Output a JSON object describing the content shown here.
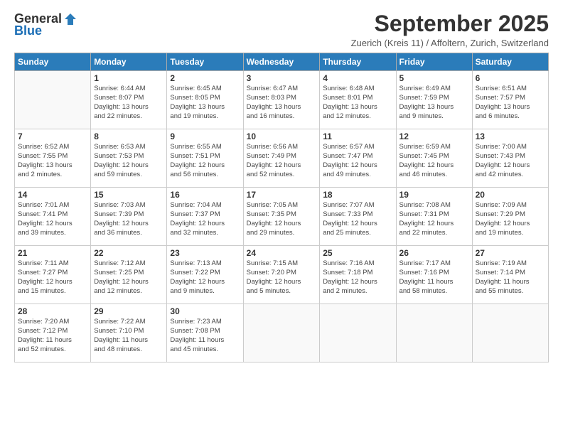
{
  "logo": {
    "general": "General",
    "blue": "Blue"
  },
  "header": {
    "title": "September 2025",
    "subtitle": "Zuerich (Kreis 11) / Affoltern, Zurich, Switzerland"
  },
  "columns": [
    "Sunday",
    "Monday",
    "Tuesday",
    "Wednesday",
    "Thursday",
    "Friday",
    "Saturday"
  ],
  "weeks": [
    [
      {
        "day": "",
        "info": ""
      },
      {
        "day": "1",
        "info": "Sunrise: 6:44 AM\nSunset: 8:07 PM\nDaylight: 13 hours\nand 22 minutes."
      },
      {
        "day": "2",
        "info": "Sunrise: 6:45 AM\nSunset: 8:05 PM\nDaylight: 13 hours\nand 19 minutes."
      },
      {
        "day": "3",
        "info": "Sunrise: 6:47 AM\nSunset: 8:03 PM\nDaylight: 13 hours\nand 16 minutes."
      },
      {
        "day": "4",
        "info": "Sunrise: 6:48 AM\nSunset: 8:01 PM\nDaylight: 13 hours\nand 12 minutes."
      },
      {
        "day": "5",
        "info": "Sunrise: 6:49 AM\nSunset: 7:59 PM\nDaylight: 13 hours\nand 9 minutes."
      },
      {
        "day": "6",
        "info": "Sunrise: 6:51 AM\nSunset: 7:57 PM\nDaylight: 13 hours\nand 6 minutes."
      }
    ],
    [
      {
        "day": "7",
        "info": "Sunrise: 6:52 AM\nSunset: 7:55 PM\nDaylight: 13 hours\nand 2 minutes."
      },
      {
        "day": "8",
        "info": "Sunrise: 6:53 AM\nSunset: 7:53 PM\nDaylight: 12 hours\nand 59 minutes."
      },
      {
        "day": "9",
        "info": "Sunrise: 6:55 AM\nSunset: 7:51 PM\nDaylight: 12 hours\nand 56 minutes."
      },
      {
        "day": "10",
        "info": "Sunrise: 6:56 AM\nSunset: 7:49 PM\nDaylight: 12 hours\nand 52 minutes."
      },
      {
        "day": "11",
        "info": "Sunrise: 6:57 AM\nSunset: 7:47 PM\nDaylight: 12 hours\nand 49 minutes."
      },
      {
        "day": "12",
        "info": "Sunrise: 6:59 AM\nSunset: 7:45 PM\nDaylight: 12 hours\nand 46 minutes."
      },
      {
        "day": "13",
        "info": "Sunrise: 7:00 AM\nSunset: 7:43 PM\nDaylight: 12 hours\nand 42 minutes."
      }
    ],
    [
      {
        "day": "14",
        "info": "Sunrise: 7:01 AM\nSunset: 7:41 PM\nDaylight: 12 hours\nand 39 minutes."
      },
      {
        "day": "15",
        "info": "Sunrise: 7:03 AM\nSunset: 7:39 PM\nDaylight: 12 hours\nand 36 minutes."
      },
      {
        "day": "16",
        "info": "Sunrise: 7:04 AM\nSunset: 7:37 PM\nDaylight: 12 hours\nand 32 minutes."
      },
      {
        "day": "17",
        "info": "Sunrise: 7:05 AM\nSunset: 7:35 PM\nDaylight: 12 hours\nand 29 minutes."
      },
      {
        "day": "18",
        "info": "Sunrise: 7:07 AM\nSunset: 7:33 PM\nDaylight: 12 hours\nand 25 minutes."
      },
      {
        "day": "19",
        "info": "Sunrise: 7:08 AM\nSunset: 7:31 PM\nDaylight: 12 hours\nand 22 minutes."
      },
      {
        "day": "20",
        "info": "Sunrise: 7:09 AM\nSunset: 7:29 PM\nDaylight: 12 hours\nand 19 minutes."
      }
    ],
    [
      {
        "day": "21",
        "info": "Sunrise: 7:11 AM\nSunset: 7:27 PM\nDaylight: 12 hours\nand 15 minutes."
      },
      {
        "day": "22",
        "info": "Sunrise: 7:12 AM\nSunset: 7:25 PM\nDaylight: 12 hours\nand 12 minutes."
      },
      {
        "day": "23",
        "info": "Sunrise: 7:13 AM\nSunset: 7:22 PM\nDaylight: 12 hours\nand 9 minutes."
      },
      {
        "day": "24",
        "info": "Sunrise: 7:15 AM\nSunset: 7:20 PM\nDaylight: 12 hours\nand 5 minutes."
      },
      {
        "day": "25",
        "info": "Sunrise: 7:16 AM\nSunset: 7:18 PM\nDaylight: 12 hours\nand 2 minutes."
      },
      {
        "day": "26",
        "info": "Sunrise: 7:17 AM\nSunset: 7:16 PM\nDaylight: 11 hours\nand 58 minutes."
      },
      {
        "day": "27",
        "info": "Sunrise: 7:19 AM\nSunset: 7:14 PM\nDaylight: 11 hours\nand 55 minutes."
      }
    ],
    [
      {
        "day": "28",
        "info": "Sunrise: 7:20 AM\nSunset: 7:12 PM\nDaylight: 11 hours\nand 52 minutes."
      },
      {
        "day": "29",
        "info": "Sunrise: 7:22 AM\nSunset: 7:10 PM\nDaylight: 11 hours\nand 48 minutes."
      },
      {
        "day": "30",
        "info": "Sunrise: 7:23 AM\nSunset: 7:08 PM\nDaylight: 11 hours\nand 45 minutes."
      },
      {
        "day": "",
        "info": ""
      },
      {
        "day": "",
        "info": ""
      },
      {
        "day": "",
        "info": ""
      },
      {
        "day": "",
        "info": ""
      }
    ]
  ]
}
